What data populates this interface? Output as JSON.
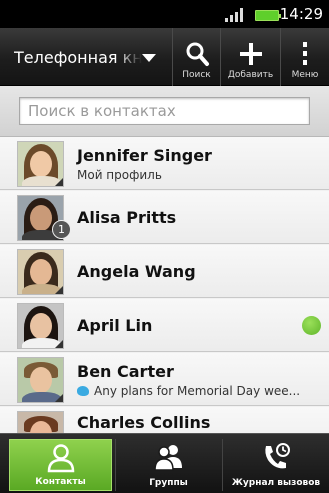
{
  "status": {
    "time": "14:29"
  },
  "action_bar": {
    "title": "Телефонная книга",
    "search_label": "Поиск",
    "add_label": "Добавить",
    "menu_label": "Меню"
  },
  "search": {
    "placeholder": "Поиск в контактах"
  },
  "contacts": [
    {
      "name": "Jennifer Singer",
      "subtitle": "Мой профиль",
      "avatar": "woman-long-hair"
    },
    {
      "name": "Alisa Pritts",
      "badge": "1",
      "avatar": "woman-dark-hair"
    },
    {
      "name": "Angela Wang",
      "avatar": "woman-long-hair"
    },
    {
      "name": "April Lin",
      "presence": "online",
      "avatar": "woman-dark-hair"
    },
    {
      "name": "Ben Carter",
      "subtitle": "Any plans for Memorial Day wee...",
      "subtitle_icon": "twitter-icon",
      "avatar": "man-short-hair"
    },
    {
      "name": "Charles Collins",
      "avatar": "man-short-hair"
    }
  ],
  "tabs": [
    {
      "label": "Контакты",
      "icon": "person-icon",
      "active": true
    },
    {
      "label": "Группы",
      "icon": "group-icon",
      "active": false
    },
    {
      "label": "Журнал вызовов",
      "icon": "call-history-icon",
      "active": false
    }
  ],
  "colors": {
    "accent_green": "#6bbd32",
    "presence_online": "#7ccf3f",
    "twitter_blue": "#3aaae1"
  }
}
